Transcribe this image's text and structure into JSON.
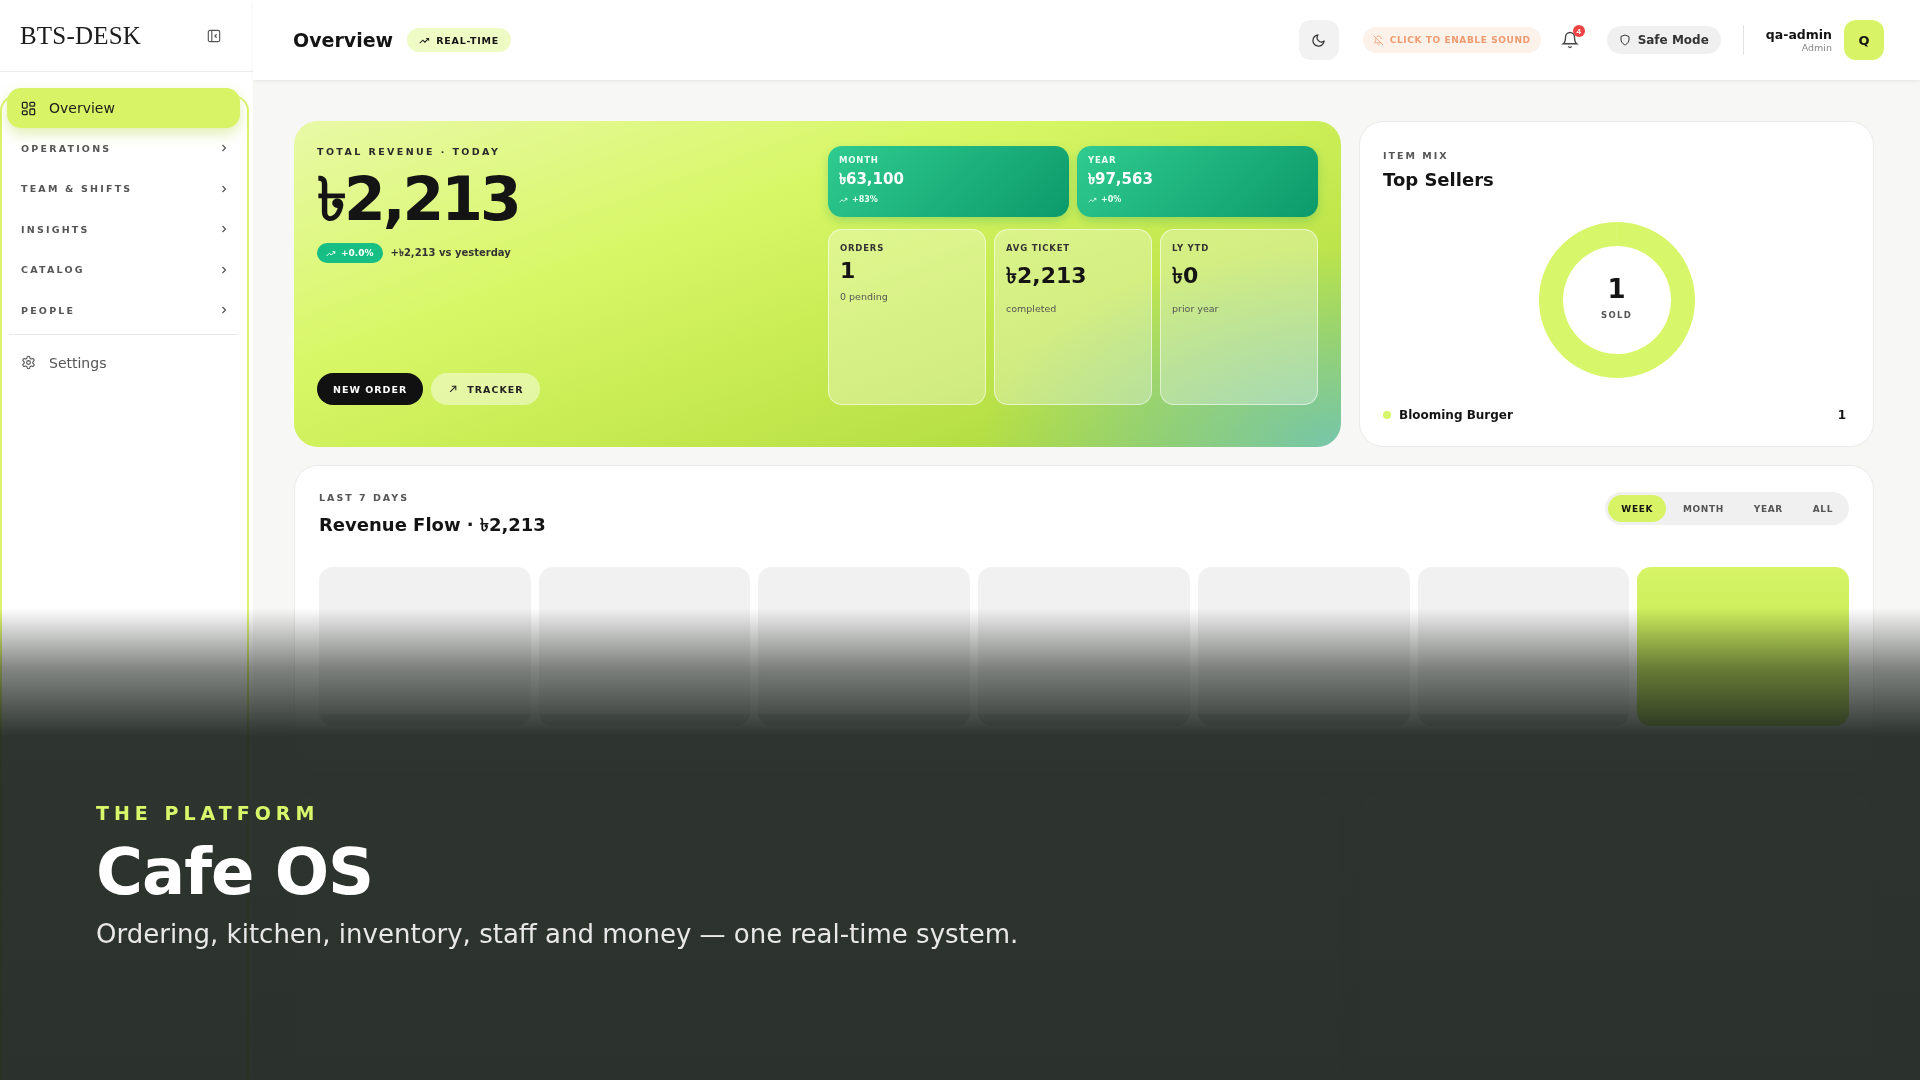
{
  "brand": {
    "name": "BTS-DESK"
  },
  "topbar": {
    "title": "Overview",
    "live_badge": "REAL-TIME",
    "sound_button": "CLICK TO ENABLE SOUND",
    "notification_count": "4",
    "safe_mode": "Safe Mode",
    "user": {
      "name": "qa-admin",
      "role": "Admin",
      "initial": "Q"
    }
  },
  "sidebar": {
    "items": [
      {
        "label": "Overview",
        "kind": "page",
        "selected": true
      },
      {
        "label": "OPERATIONS",
        "kind": "section",
        "selected": false,
        "expanded": false
      },
      {
        "label": "TEAM & SHIFTS",
        "kind": "section",
        "selected": false,
        "expanded": false
      },
      {
        "label": "INSIGHTS",
        "kind": "section",
        "selected": false,
        "expanded": false
      },
      {
        "label": "CATALOG",
        "kind": "section",
        "selected": false,
        "expanded": false
      },
      {
        "label": "PEOPLE",
        "kind": "section",
        "selected": false,
        "expanded": false
      }
    ],
    "settings": {
      "label": "Settings",
      "selected": false
    }
  },
  "revenue": {
    "label": "TOTAL REVENUE · TODAY",
    "amount": "৳2,213",
    "change": "+0.0%",
    "comparison": "+৳2,213 vs yesterday",
    "actions": [
      {
        "label": "NEW ORDER",
        "kind": "primary"
      },
      {
        "label": "TRACKER",
        "kind": "secondary"
      }
    ],
    "period_tiles": [
      {
        "label": "MONTH",
        "value": "৳63,100",
        "change": "+83%"
      },
      {
        "label": "YEAR",
        "value": "৳97,563",
        "change": "+0%"
      }
    ],
    "stat_tiles": [
      {
        "label": "ORDERS",
        "value": "1",
        "note": "0 pending"
      },
      {
        "label": "AVG TICKET",
        "value": "৳2,213",
        "note": "completed"
      },
      {
        "label": "LY YTD",
        "value": "৳0",
        "note": "prior year"
      }
    ]
  },
  "top_sellers": {
    "eyebrow": "ITEM MIX",
    "title": "Top Sellers",
    "total": "1",
    "total_label": "SOLD",
    "items": [
      {
        "name": "Blooming Burger",
        "count": "1",
        "color": "#d8f66a"
      }
    ]
  },
  "revenue_flow": {
    "eyebrow": "LAST 7 DAYS",
    "title": "Revenue Flow · ৳2,213",
    "ranges": [
      {
        "label": "WEEK",
        "selected": true
      },
      {
        "label": "MONTH",
        "selected": false
      },
      {
        "label": "YEAR",
        "selected": false
      },
      {
        "label": "ALL",
        "selected": false
      }
    ],
    "days": [
      {
        "highlighted": false
      },
      {
        "highlighted": false
      },
      {
        "highlighted": false
      },
      {
        "highlighted": false
      },
      {
        "highlighted": false
      },
      {
        "highlighted": false
      },
      {
        "highlighted": true
      }
    ]
  },
  "promo_overlay": {
    "eyebrow": "THE PLATFORM",
    "title": "Cafe OS",
    "tagline": "Ordering, kitchen, inventory, staff and money — one real-time system."
  }
}
